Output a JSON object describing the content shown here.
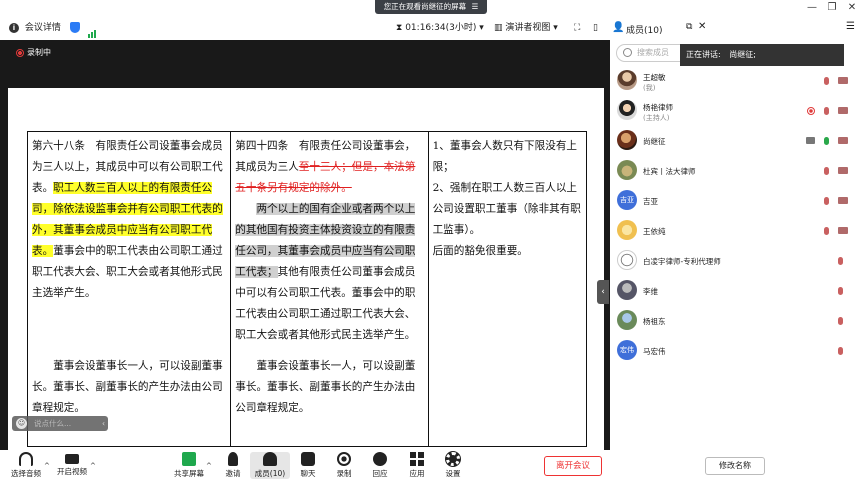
{
  "banner": {
    "text": "您正在观看尚继征的屏幕",
    "control": "☰"
  },
  "window": {
    "minimize": "—",
    "restore": "❐",
    "close": "✕"
  },
  "meeting": {
    "details_label": "会议详情",
    "timer": "01:16:34(3小时)",
    "view_mode": "演讲者视图",
    "recording_label": "录制中"
  },
  "participants_header": {
    "title": "成员(10)"
  },
  "speaking": {
    "label": "正在讲话:",
    "name": "尚继征;"
  },
  "search": {
    "placeholder": "搜索成员"
  },
  "participants": [
    {
      "name": "王超敏",
      "role": "(我)",
      "avatar": "photo",
      "mic": "muted",
      "cam": "off"
    },
    {
      "name": "杨艳律师",
      "role": "(主持人)",
      "avatar": "photo2",
      "mic": "muted",
      "cam": "off",
      "recording": true
    },
    {
      "name": "尚继征",
      "avatar": "photo3",
      "mic": "on",
      "cam": "off",
      "sharing": true
    },
    {
      "name": "杜宾丨法大律师",
      "avatar": "photo4",
      "mic": "muted",
      "cam": "off"
    },
    {
      "name": "吉亚",
      "avatar_text": "吉亚",
      "mic": "muted",
      "cam": "off"
    },
    {
      "name": "王依纯",
      "avatar": "photo5",
      "mic": "muted",
      "cam": "off"
    },
    {
      "name": "白凌宇律师-专利代理师",
      "avatar": "photo6",
      "mic": "muted"
    },
    {
      "name": "李维",
      "avatar": "photo7",
      "mic": "muted"
    },
    {
      "name": "杨祖东",
      "avatar": "photo8",
      "mic": "muted"
    },
    {
      "name": "马宏伟",
      "avatar_text": "宏伟",
      "mic": "muted"
    }
  ],
  "document": {
    "col1": {
      "p1_pre": "第六十八条　有限责任公司设董事会成员为三人以上，其成员中可以有公司职工代表。",
      "p1_hl": "职工人数三百人以上的有限责任公司，除依法设监事会并有公司职工代表的外，其董事会成员中应当有公司职工代表。",
      "p1_post": "董事会中的职工代表由公司职工通过职工代表大会、职工大会或者其他形式民主选举产生。",
      "p2": "董事会设董事长一人，可以设副董事长。董事长、副董事长的产生办法由公司章程规定。"
    },
    "col2": {
      "p1_pre": "第四十四条　有限责任公司设董事会，其成员为三人",
      "p1_strike": "至十三人；但是，本法第五十条另有规定的除外。",
      "p2_gray": "两个以上的国有企业或者两个以上的其他国有投资主体投资设立的有限责任公司，其董事会成员中应当有公司职工代表；",
      "p2_post": "其他有限责任公司董事会成员中可以有公司职工代表。董事会中的职工代表由公司职工通过职工代表大会、职工大会或者其他形式民主选举产生。",
      "p3": "董事会设董事长一人，可以设副董事长。董事长、副董事长的产生办法由公司章程规定。"
    },
    "col3": {
      "p1": "1、董事会人数只有下限没有上限；",
      "p2": "2、强制在职工人数三百人以上公司设置职工董事（除非其有职工监事）。",
      "p3": "后面的豁免很重要。"
    }
  },
  "chat_input": {
    "placeholder": "说点什么..."
  },
  "toolbar": {
    "audio": "选择音频",
    "video": "开启视频",
    "share": "共享屏幕",
    "invite": "邀请",
    "members": "成员(10)",
    "chat": "聊天",
    "record": "录制",
    "react": "回应",
    "apps": "应用",
    "settings": "设置",
    "leave": "离开会议",
    "rename": "修改名称"
  }
}
